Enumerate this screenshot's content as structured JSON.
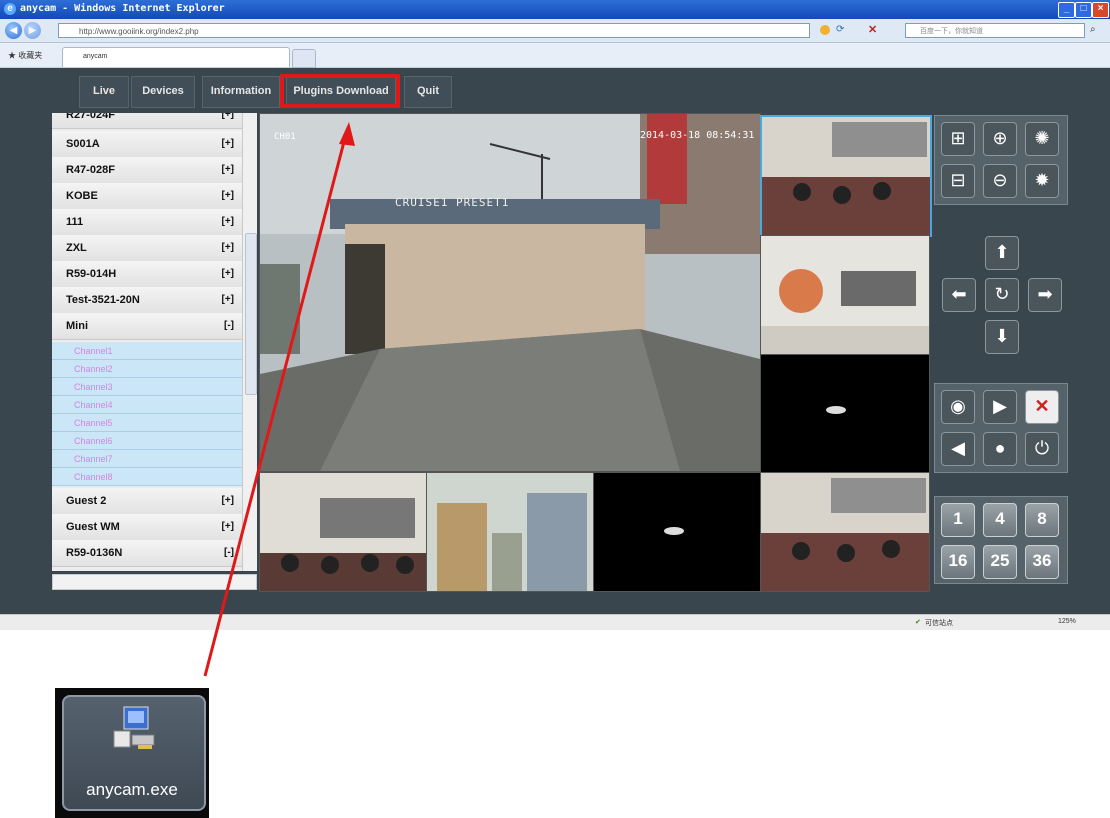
{
  "window": {
    "title": "anycam - Windows Internet Explorer",
    "url": "http://www.gooiink.org/index2.php",
    "search_placeholder": "百度一下，你就知道",
    "favorites_label": "收藏夹",
    "tab_label": "anycam",
    "status_text": "可信站点",
    "zoom": "125%"
  },
  "nav": {
    "items": [
      "Live",
      "Devices",
      "Information",
      "Plugins Download",
      "Quit"
    ]
  },
  "devices": [
    {
      "name": "R27-024F",
      "toggle": "[+]"
    },
    {
      "name": "S001A",
      "toggle": "[+]"
    },
    {
      "name": "R47-028F",
      "toggle": "[+]"
    },
    {
      "name": "KOBE",
      "toggle": "[+]"
    },
    {
      "name": "111",
      "toggle": "[+]"
    },
    {
      "name": "ZXL",
      "toggle": "[+]"
    },
    {
      "name": "R59-014H",
      "toggle": "[+]"
    },
    {
      "name": "Test-3521-20N",
      "toggle": "[+]"
    },
    {
      "name": "Mini",
      "toggle": "[-]"
    }
  ],
  "channels": [
    "Channel1",
    "Channel2",
    "Channel3",
    "Channel4",
    "Channel5",
    "Channel6",
    "Channel7",
    "Channel8"
  ],
  "devices_after": [
    {
      "name": "Guest 2",
      "toggle": "[+]"
    },
    {
      "name": "Guest WM",
      "toggle": "[+]"
    },
    {
      "name": "R59-0136N",
      "toggle": "[-]"
    }
  ],
  "main_video": {
    "channel_label": "CH01",
    "timestamp": "2014-03-18 08:54:31",
    "preset_label": "CRUISE1 PRESET1"
  },
  "controls": {
    "ptz": [
      "zoom-in-frame-icon",
      "zoom-in-icon",
      "iris-open-icon",
      "zoom-out-frame-icon",
      "zoom-out-icon",
      "iris-close-icon"
    ],
    "direction": [
      "arrow-up-icon",
      "arrow-left-icon",
      "refresh-icon",
      "arrow-right-icon",
      "arrow-down-icon"
    ],
    "actions": [
      "camera-icon",
      "video-record-icon",
      "close-x-icon",
      "speaker-icon",
      "microphone-icon",
      "power-icon"
    ],
    "layouts": [
      "1",
      "4",
      "8",
      "16",
      "25",
      "36"
    ]
  },
  "exe_label": "anycam.exe",
  "colors": {
    "highlight": "#e01818",
    "page_bg": "#3a464d",
    "channel_text": "#d784e0"
  }
}
